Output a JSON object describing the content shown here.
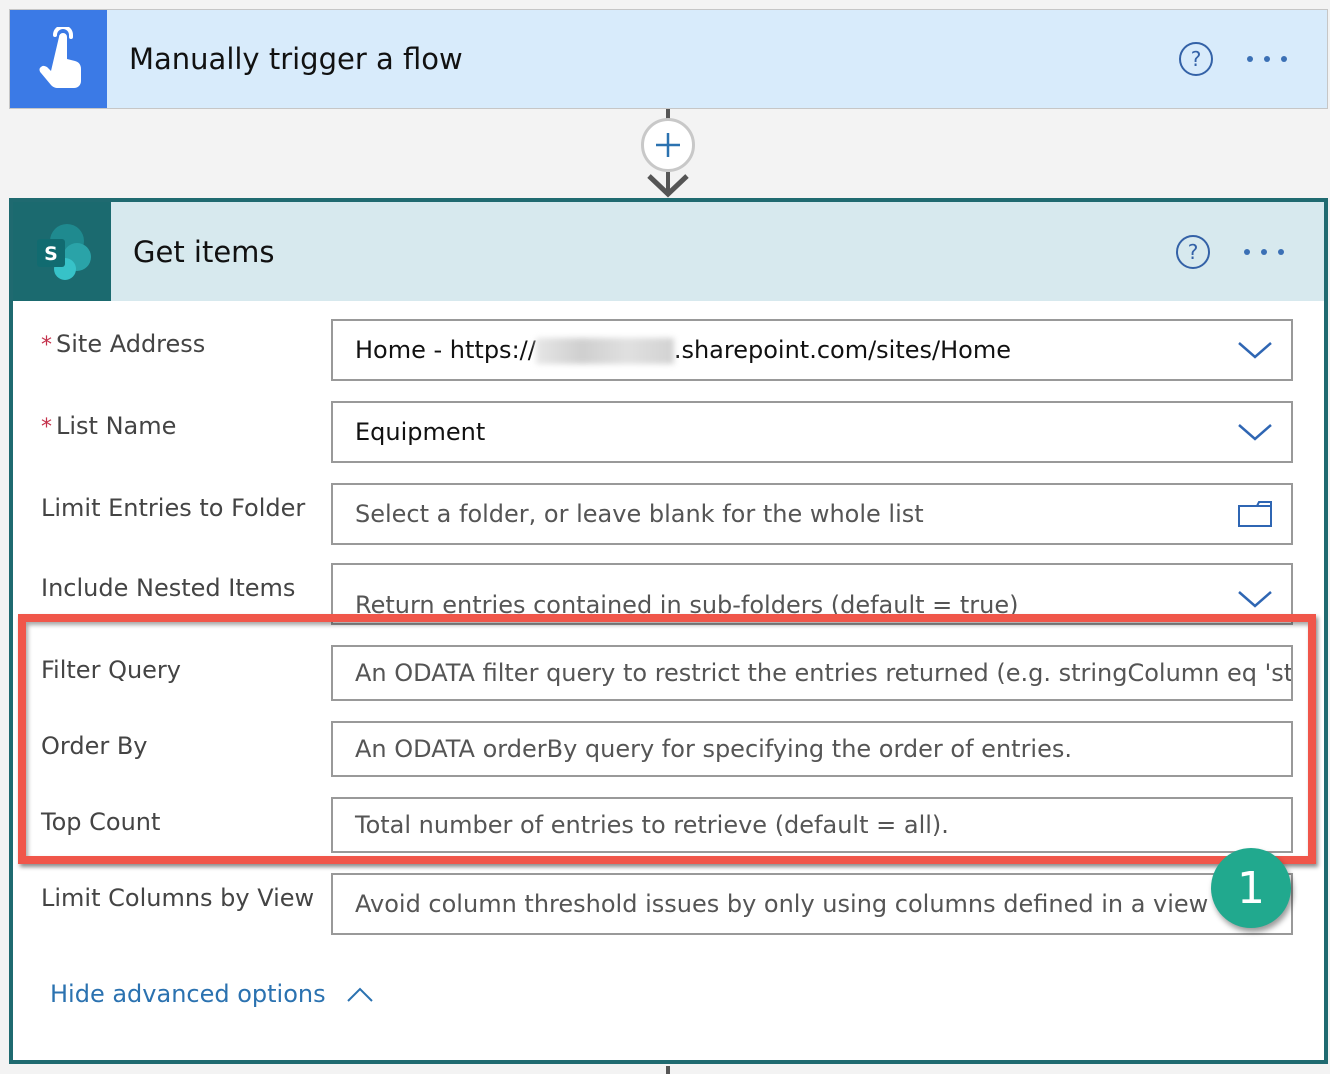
{
  "trigger": {
    "title": "Manually trigger a flow",
    "icon": "touch-hand-icon",
    "icon_bg": "#3b7ae6",
    "header_bg": "#d8ebfb"
  },
  "connector": {
    "add_icon": "plus-icon",
    "arrow_icon": "arrow-down-icon"
  },
  "action": {
    "title": "Get items",
    "icon": "sharepoint-icon",
    "icon_letter": "S",
    "accent": "#1f6a70",
    "header_bg": "#d7e9ee",
    "fields": [
      {
        "label": "Site Address",
        "required": true,
        "value_prefix": "Home - https://",
        "value_suffix": ".sharepoint.com/sites/Home",
        "placeholder": "",
        "trail_icon": "chevron-down-icon"
      },
      {
        "label": "List Name",
        "required": true,
        "value": "Equipment",
        "placeholder": "",
        "trail_icon": "chevron-down-icon"
      },
      {
        "label": "Limit Entries to Folder",
        "required": false,
        "value": "",
        "placeholder": "Select a folder, or leave blank for the whole list",
        "trail_icon": "folder-icon"
      },
      {
        "label": "Include Nested Items",
        "required": false,
        "value": "",
        "placeholder": "Return entries contained in sub-folders (default = true)",
        "trail_icon": "chevron-down-icon"
      },
      {
        "label": "Filter Query",
        "required": false,
        "value": "",
        "placeholder": "An ODATA filter query to restrict the entries returned (e.g. stringColumn eq 'stı"
      },
      {
        "label": "Order By",
        "required": false,
        "value": "",
        "placeholder": "An ODATA orderBy query for specifying the order of entries."
      },
      {
        "label": "Top Count",
        "required": false,
        "value": "",
        "placeholder": "Total number of entries to retrieve (default = all)."
      },
      {
        "label": "Limit Columns by View",
        "required": false,
        "value": "",
        "placeholder": "Avoid column threshold issues by only using columns defined in a view"
      }
    ],
    "required_marker": "*",
    "hide_advanced_label": "Hide advanced options"
  },
  "annotation": {
    "badge_number": "1",
    "highlight_color": "#f0564a",
    "badge_color": "#21a98e"
  }
}
